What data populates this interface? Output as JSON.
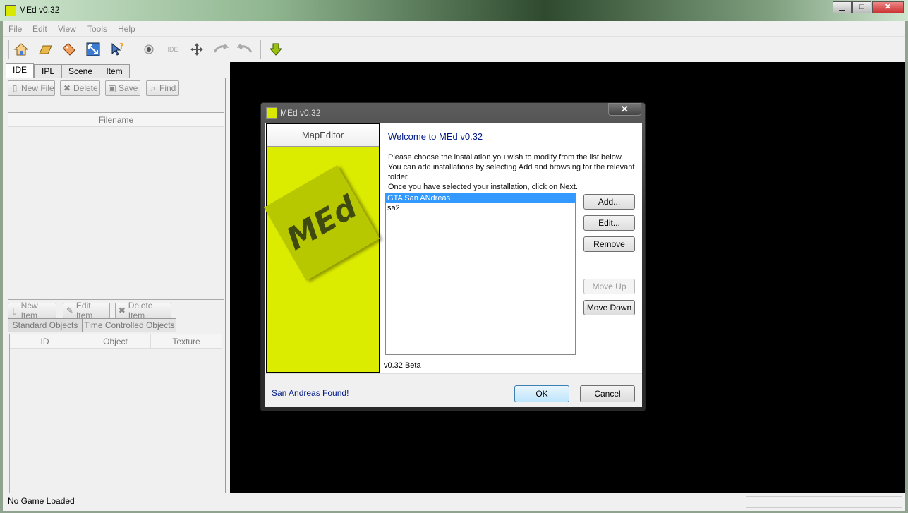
{
  "window": {
    "title": "MEd v0.32",
    "minimize": "▁",
    "maximize": "□",
    "close": "✕"
  },
  "menu": [
    "File",
    "Edit",
    "View",
    "Tools",
    "Help"
  ],
  "toolbar": {
    "icons": [
      "home-icon",
      "open-folder-icon",
      "tag-icon",
      "resize-icon",
      "help-cursor-icon",
      "record-icon",
      "ide-icon",
      "move-icon",
      "undo-icon",
      "redo-icon",
      "download-arrow-icon"
    ]
  },
  "left": {
    "tabs": [
      "IDE",
      "IPL",
      "Scene",
      "Item"
    ],
    "file_buttons": {
      "new": "New File",
      "delete": "Delete",
      "save": "Save",
      "find": "Find"
    },
    "file_list_header": "Filename",
    "item_buttons": {
      "new": "New Item",
      "edit": "Edit Item",
      "delete": "Delete Item"
    },
    "subtabs": [
      "Standard Objects",
      "Time Controlled Objects"
    ],
    "object_columns": [
      "ID",
      "Object",
      "Texture"
    ]
  },
  "status": {
    "text": "No Game Loaded"
  },
  "dialog": {
    "title": "MEd v0.32",
    "close": "✕",
    "banner_title": "MapEditor",
    "logo_text": "MEd",
    "welcome": "Welcome to MEd v0.32",
    "desc_line1": "Please choose the installation you wish to modify from the list below. You can add installations by selecting Add and browsing for the relevant folder.",
    "desc_line2": "Once you have selected your installation, click on Next.",
    "installations": [
      "GTA San ANdreas",
      "sa2"
    ],
    "buttons": {
      "add": "Add...",
      "edit": "Edit...",
      "remove": "Remove",
      "move_up": "Move Up",
      "move_down": "Move Down"
    },
    "version": "v0.32 Beta",
    "status": "San Andreas Found!",
    "ok": "OK",
    "cancel": "Cancel"
  },
  "colors": {
    "accent": "#dcec00",
    "selection": "#3399ff",
    "link_blue": "#001a88"
  }
}
